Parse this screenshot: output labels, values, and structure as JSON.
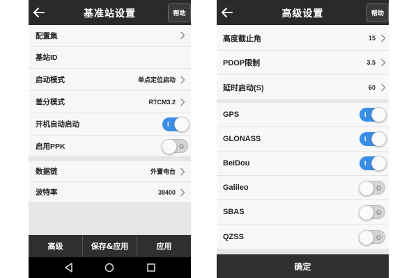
{
  "left_screen": {
    "header": {
      "title": "基准站设置",
      "help_label": "帮助"
    },
    "rows": {
      "config_set": {
        "label": "配置集"
      },
      "base_id": {
        "label": "基站ID"
      },
      "start_mode": {
        "label": "启动模式",
        "value": "单点定位启动"
      },
      "diff_format": {
        "label": "差分模式",
        "value": "RTCM3.2"
      },
      "auto_start": {
        "label": "开机自动启动",
        "toggle_on": true,
        "on_mark": "I",
        "off_mark": "O"
      },
      "enable_ppk": {
        "label": "启用PPK",
        "toggle_on": false,
        "on_mark": "I",
        "off_mark": "O"
      },
      "data_link": {
        "label": "数据链",
        "value": "外置电台"
      },
      "baud_rate": {
        "label": "波特率",
        "value": "38400"
      }
    },
    "bottom_buttons": {
      "advanced": "高级",
      "save_apply": "保存&应用",
      "apply": "应用"
    },
    "nav_icons": [
      "back-triangle-icon",
      "home-circle-icon",
      "recent-square-icon"
    ]
  },
  "right_screen": {
    "header": {
      "title": "高级设置",
      "help_label": "帮助"
    },
    "rows": {
      "elevation_mask": {
        "label": "高度截止角",
        "value": "15"
      },
      "pdop_limit": {
        "label": "PDOP限制",
        "value": "3.5"
      },
      "delay_start": {
        "label": "延时启动(S)",
        "value": "60"
      }
    },
    "constellations": {
      "gps": {
        "label": "GPS",
        "toggle_on": true,
        "on_mark": "I"
      },
      "glonass": {
        "label": "GLONASS",
        "toggle_on": true,
        "on_mark": "I"
      },
      "beidou": {
        "label": "BeiDou",
        "toggle_on": true,
        "on_mark": "I"
      },
      "galileo": {
        "label": "Galileo",
        "toggle_on": false,
        "off_mark": "O"
      },
      "sbas": {
        "label": "SBAS",
        "toggle_on": false,
        "off_mark": "O"
      },
      "qzss": {
        "label": "QZSS",
        "toggle_on": false,
        "off_mark": "O"
      }
    },
    "confirm_label": "确定"
  },
  "colors": {
    "header": "#2a2a2a",
    "toggle_on": "#3a8ee6",
    "toggle_off": "#d4d4d4",
    "bottom_bar": "#2f2f2f",
    "divider": "#e6e6e6"
  }
}
